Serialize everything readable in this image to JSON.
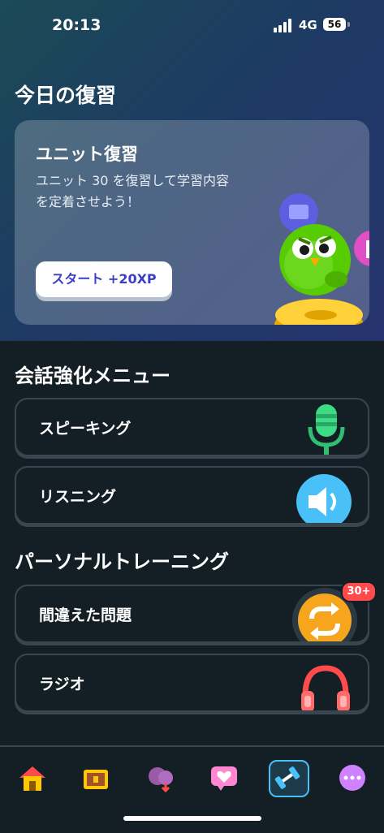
{
  "status_bar": {
    "time": "20:13",
    "network": "4G",
    "battery": "56"
  },
  "review": {
    "title": "今日の復習",
    "card_title": "ユニット復習",
    "card_desc": "ユニット 30 を復習して学習内容を定着させよう！",
    "start_label": "スタート +20XP"
  },
  "conversation": {
    "title": "会話強化メニュー",
    "items": [
      {
        "label": "スピーキング",
        "icon": "microphone-icon"
      },
      {
        "label": "リスニング",
        "icon": "speaker-icon"
      }
    ]
  },
  "personal": {
    "title": "パーソナルトレーニング",
    "items": [
      {
        "label": "間違えた問題",
        "icon": "repeat-icon",
        "badge": "30+"
      },
      {
        "label": "ラジオ",
        "icon": "headphones-icon"
      }
    ]
  },
  "tabbar": {
    "tabs": [
      "home-icon",
      "treasure-chest-icon",
      "league-icon",
      "heart-chat-icon",
      "dumbbell-icon",
      "more-icon"
    ],
    "active": "dumbbell-icon"
  },
  "colors": {
    "background": "#131f24",
    "card_border": "#37464f",
    "start_text": "#3b3ec7",
    "badge": "#ff4b4b",
    "active_tab": "#49c0f8"
  }
}
